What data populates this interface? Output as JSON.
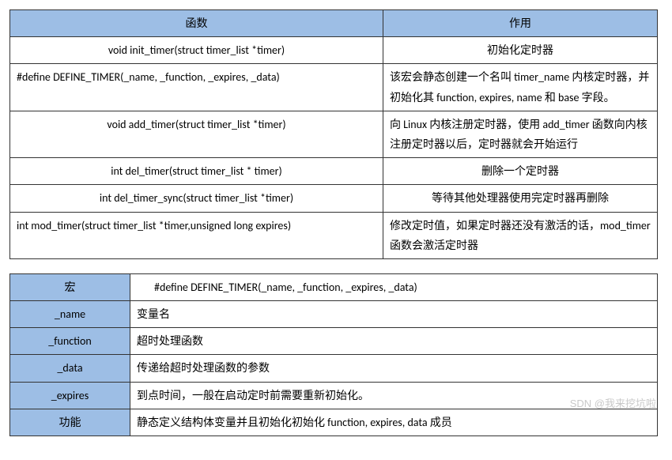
{
  "table1": {
    "headers": [
      "函数",
      "作用"
    ],
    "rows": [
      {
        "func": "void init_timer(struct timer_list *timer)",
        "desc": "初始化定时器"
      },
      {
        "func": "#define DEFINE_TIMER(_name, _function, _expires, _data)",
        "desc": "该宏会静态创建一个名叫 timer_name 内核定时器，并初始化其 function, expires, name 和 base 字段。"
      },
      {
        "func": "void add_timer(struct timer_list *timer)",
        "desc": "向 Linux 内核注册定时器，使用 add_timer 函数向内核注册定时器以后，定时器就会开始运行"
      },
      {
        "func": "int del_timer(struct timer_list * timer)",
        "desc": "删除一个定时器"
      },
      {
        "func": "int del_timer_sync(struct timer_list *timer)",
        "desc": "等待其他处理器使用完定时器再删除"
      },
      {
        "func": "int mod_timer(struct timer_list *timer,unsigned long expires)",
        "desc": "修改定时值，如果定时器还没有激活的话，mod_timer 函数会激活定时器"
      }
    ]
  },
  "table2": {
    "rows": [
      {
        "label": "宏",
        "value": "#define DEFINE_TIMER(_name, _function, _expires, _data)"
      },
      {
        "label": "_name",
        "value": "变量名"
      },
      {
        "label": "_function",
        "value": "超时处理函数"
      },
      {
        "label": "_data",
        "value": "传递给超时处理函数的参数"
      },
      {
        "label": "_expires",
        "value": "到点时间，一般在启动定时前需要重新初始化。"
      },
      {
        "label": "功能",
        "value": "静态定义结构体变量并且初始化初始化 function, expires, data 成员"
      }
    ]
  },
  "watermark": "SDN @我来挖坑啦"
}
